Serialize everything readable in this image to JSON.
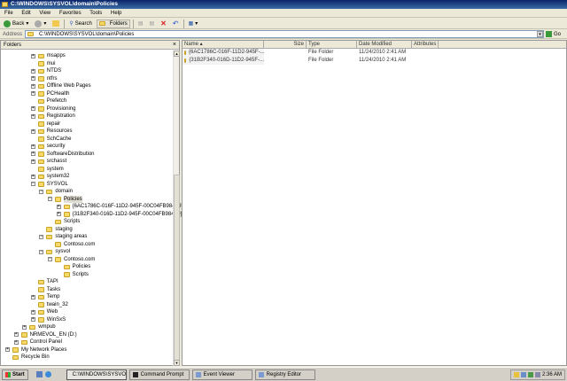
{
  "window": {
    "title": "C:\\WINDOWS\\SYSVOL\\domain\\Policies"
  },
  "menu": [
    "File",
    "Edit",
    "View",
    "Favorites",
    "Tools",
    "Help"
  ],
  "toolbar": {
    "back": "Back",
    "search": "Search",
    "folders": "Folders"
  },
  "address": {
    "label": "Address",
    "value": "C:\\WINDOWS\\SYSVOL\\domain\\Policies",
    "go": "Go"
  },
  "folders_pane": {
    "title": "Folders",
    "close": "×",
    "items": [
      {
        "label": "msapps",
        "level": 3,
        "exp": "+"
      },
      {
        "label": "mui",
        "level": 3,
        "exp": ""
      },
      {
        "label": "NTDS",
        "level": 3,
        "exp": "+"
      },
      {
        "label": "ntfrs",
        "level": 3,
        "exp": "+"
      },
      {
        "label": "Offline Web Pages",
        "level": 3,
        "exp": "+"
      },
      {
        "label": "PCHealth",
        "level": 3,
        "exp": "+"
      },
      {
        "label": "Prefetch",
        "level": 3,
        "exp": ""
      },
      {
        "label": "Provisioning",
        "level": 3,
        "exp": "+"
      },
      {
        "label": "Registration",
        "level": 3,
        "exp": "+"
      },
      {
        "label": "repair",
        "level": 3,
        "exp": ""
      },
      {
        "label": "Resources",
        "level": 3,
        "exp": "+"
      },
      {
        "label": "SchCache",
        "level": 3,
        "exp": ""
      },
      {
        "label": "security",
        "level": 3,
        "exp": "+"
      },
      {
        "label": "SoftwareDistribution",
        "level": 3,
        "exp": "+"
      },
      {
        "label": "srchasst",
        "level": 3,
        "exp": "+"
      },
      {
        "label": "system",
        "level": 3,
        "exp": ""
      },
      {
        "label": "system32",
        "level": 3,
        "exp": "+"
      },
      {
        "label": "SYSVOL",
        "level": 3,
        "exp": "-"
      },
      {
        "label": "domain",
        "level": 4,
        "exp": "-"
      },
      {
        "label": "Policies",
        "level": 5,
        "exp": "-",
        "selected": true
      },
      {
        "label": "{6AC1786C-016F-11D2-945F-00C04FB984F9}",
        "level": 6,
        "exp": "+"
      },
      {
        "label": "{31B2F340-016D-11D2-945F-00C04FB984F9}",
        "level": 6,
        "exp": "+"
      },
      {
        "label": "Scripts",
        "level": 5,
        "exp": ""
      },
      {
        "label": "staging",
        "level": 4,
        "exp": ""
      },
      {
        "label": "staging areas",
        "level": 4,
        "exp": "-"
      },
      {
        "label": "Contoso.com",
        "level": 5,
        "exp": ""
      },
      {
        "label": "sysvol",
        "level": 4,
        "exp": "-"
      },
      {
        "label": "Contoso.com",
        "level": 5,
        "exp": "-"
      },
      {
        "label": "Policies",
        "level": 6,
        "exp": ""
      },
      {
        "label": "Scripts",
        "level": 6,
        "exp": ""
      },
      {
        "label": "TAPI",
        "level": 3,
        "exp": ""
      },
      {
        "label": "Tasks",
        "level": 3,
        "exp": ""
      },
      {
        "label": "Temp",
        "level": 3,
        "exp": "+"
      },
      {
        "label": "twain_32",
        "level": 3,
        "exp": ""
      },
      {
        "label": "Web",
        "level": 3,
        "exp": "+"
      },
      {
        "label": "WinSxS",
        "level": 3,
        "exp": "+"
      },
      {
        "label": "wmpub",
        "level": 2,
        "exp": "+"
      },
      {
        "label": "NRMEVOL_EN (D:)",
        "level": 1,
        "exp": "+"
      },
      {
        "label": "Control Panel",
        "level": 1,
        "exp": "+"
      },
      {
        "label": "My Network Places",
        "level": 0,
        "exp": "+"
      },
      {
        "label": "Recycle Bin",
        "level": 0,
        "exp": ""
      }
    ]
  },
  "file_list": {
    "columns": [
      "Name",
      "Size",
      "Type",
      "Date Modified",
      "Attributes"
    ],
    "rows": [
      {
        "name": "{6AC1786C-016F-11D2-945F-...",
        "size": "",
        "type": "File Folder",
        "date": "11/24/2010 2:41 AM",
        "attr": ""
      },
      {
        "name": "{31B2F340-016D-11D2-945F-...",
        "size": "",
        "type": "File Folder",
        "date": "11/24/2010 2:41 AM",
        "attr": ""
      }
    ]
  },
  "taskbar": {
    "start": "Start",
    "tasks": [
      {
        "label": "C:\\WINDOWS\\SYSVO...",
        "active": true
      },
      {
        "label": "Command Prompt"
      },
      {
        "label": "Event Viewer"
      },
      {
        "label": "Registry Editor"
      }
    ],
    "clock": "2:36 AM"
  }
}
